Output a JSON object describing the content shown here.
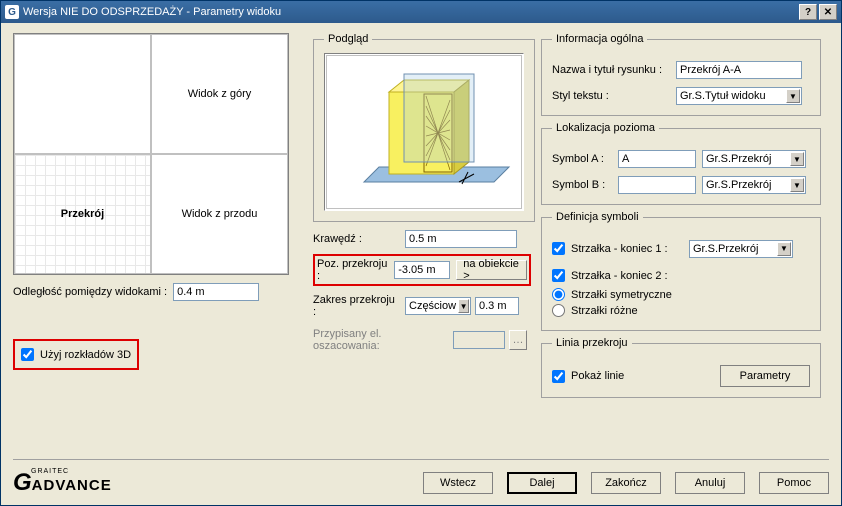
{
  "title": "Wersja NIE DO ODSPRZEDAŻY - Parametry widoku",
  "grid": {
    "tl": "",
    "tr": "Widok z góry",
    "bl": "Przekrój",
    "br": "Widok z przodu"
  },
  "left": {
    "dist_label": "Odległość pomiędzy widokami :",
    "dist_value": "0.4 m",
    "use3d_label": "Użyj rozkładów 3D"
  },
  "preview": {
    "legend": "Podgląd"
  },
  "mid": {
    "edge_label": "Krawędź :",
    "edge_value": "0.5 m",
    "pos_label": "Poz. przekroju :",
    "pos_value": "-3.05 m",
    "on_object": "na obiekcie >",
    "range_label": "Zakres przekroju :",
    "range_sel": "Częściow",
    "range_value": "0.3 m",
    "assigned_label": "Przypisany el. oszacowania:"
  },
  "info": {
    "legend": "Informacja ogólna",
    "name_label": "Nazwa i tytuł rysunku :",
    "name_value": "Przekrój A-A",
    "style_label": "Styl tekstu :",
    "style_value": "Gr.S.Tytuł widoku"
  },
  "loc": {
    "legend": "Lokalizacja pozioma",
    "symA_label": "Symbol A :",
    "symA_value": "A",
    "symA_style": "Gr.S.Przekrój",
    "symB_label": "Symbol B :",
    "symB_value": "",
    "symB_style": "Gr.S.Przekrój"
  },
  "def": {
    "legend": "Definicja symboli",
    "arrow1_label": "Strzałka - koniec 1 :",
    "arrow1_style": "Gr.S.Przekrój",
    "arrow2_label": "Strzałka - koniec 2 :",
    "sym_label": "Strzałki symetryczne",
    "diff_label": "Strzałki różne"
  },
  "line": {
    "legend": "Linia przekroju",
    "show_label": "Pokaż linie",
    "params_btn": "Parametry"
  },
  "footer": {
    "back": "Wstecz",
    "next": "Dalej",
    "finish": "Zakończ",
    "cancel": "Anuluj",
    "help": "Pomoc"
  },
  "logo": {
    "company": "GRAITEC",
    "product": "ADVANCE"
  }
}
